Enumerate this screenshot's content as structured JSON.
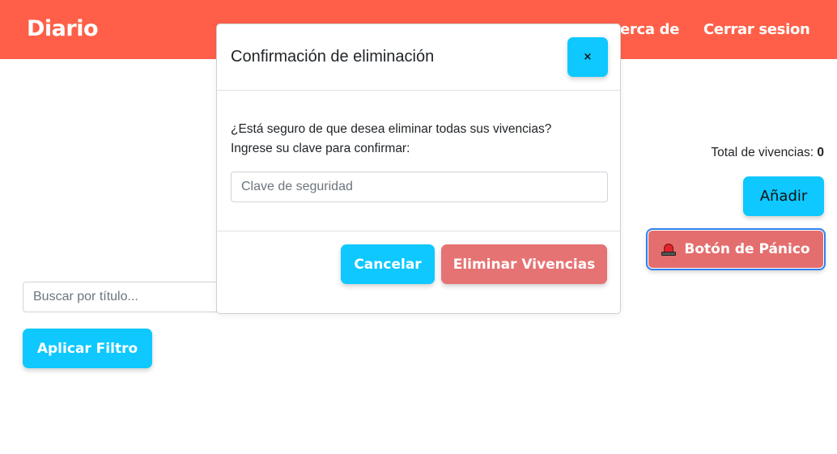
{
  "navbar": {
    "brand": "Diario",
    "links": [
      "Acerca de",
      "Cerrar sesion"
    ]
  },
  "sidebar_right": {
    "total_label": "Total de vivencias:",
    "total_count": "0",
    "add_button": "Añadir",
    "panic_button": "Botón de Pánico"
  },
  "filter": {
    "search_placeholder": "Buscar por título...",
    "apply_button": "Aplicar Filtro"
  },
  "modal": {
    "title": "Confirmación de eliminación",
    "close_label": "×",
    "message_line1": "¿Está seguro de que desea eliminar todas sus vivencias?",
    "message_line2": "Ingrese su clave para confirmar:",
    "password_placeholder": "Clave de seguridad",
    "cancel_button": "Cancelar",
    "delete_button": "Eliminar Vivencias"
  },
  "colors": {
    "navbar": "#ff5f48",
    "primary_button": "#0ec8ff",
    "danger_button": "#e67373"
  },
  "icons": {
    "panic": "siren-icon"
  }
}
